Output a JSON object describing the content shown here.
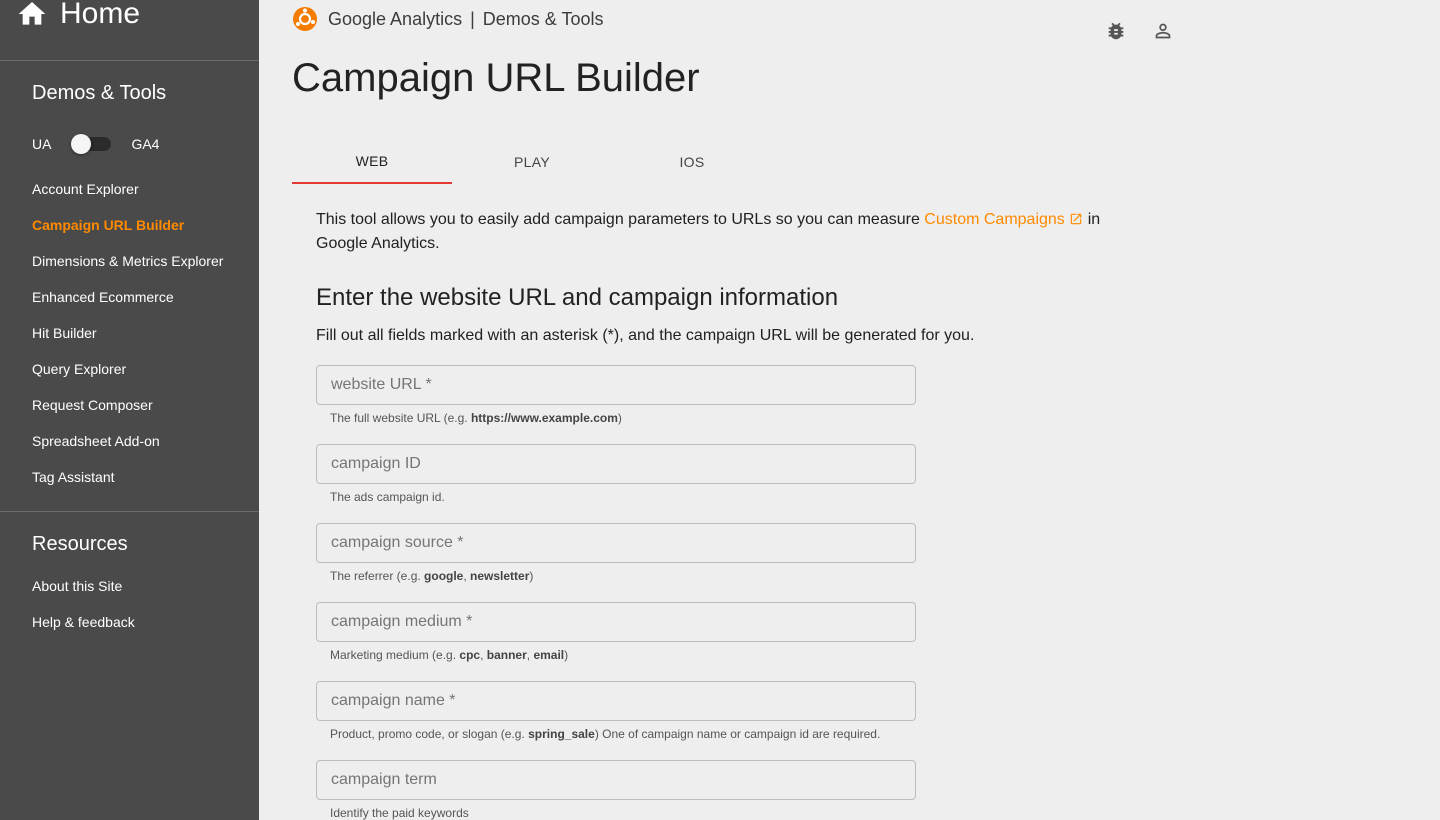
{
  "sidebar": {
    "home_label": "Home",
    "section1_title": "Demos & Tools",
    "toggle_left": "UA",
    "toggle_right": "GA4",
    "items": [
      {
        "label": "Account Explorer",
        "active": false
      },
      {
        "label": "Campaign URL Builder",
        "active": true
      },
      {
        "label": "Dimensions & Metrics Explorer",
        "active": false
      },
      {
        "label": "Enhanced Ecommerce",
        "active": false
      },
      {
        "label": "Hit Builder",
        "active": false
      },
      {
        "label": "Query Explorer",
        "active": false
      },
      {
        "label": "Request Composer",
        "active": false
      },
      {
        "label": "Spreadsheet Add-on",
        "active": false
      },
      {
        "label": "Tag Assistant",
        "active": false
      }
    ],
    "section2_title": "Resources",
    "resources": [
      {
        "label": "About this Site"
      },
      {
        "label": "Help & feedback"
      }
    ]
  },
  "header": {
    "brand": "Google Analytics",
    "separator": "|",
    "product": "Demos & Tools",
    "icons": [
      "bug-icon",
      "account-icon"
    ]
  },
  "page": {
    "title": "Campaign URL Builder",
    "tabs": [
      {
        "label": "WEB",
        "active": true
      },
      {
        "label": "PLAY",
        "active": false
      },
      {
        "label": "IOS",
        "active": false
      }
    ],
    "intro_before": "This tool allows you to easily add campaign parameters to URLs so you can measure ",
    "intro_link": "Custom Campaigns",
    "intro_after": " in Google Analytics.",
    "form_heading": "Enter the website URL and campaign information",
    "form_sub": "Fill out all fields marked with an asterisk (*), and the campaign URL will be generated for you."
  },
  "form": {
    "fields": [
      {
        "placeholder": "website URL *",
        "value": "",
        "helper": [
          "The full website URL (e.g. ",
          "https://www.example.com",
          ")"
        ]
      },
      {
        "placeholder": "campaign ID",
        "value": "",
        "helper": [
          "The ads campaign id."
        ]
      },
      {
        "placeholder": "campaign source *",
        "value": "",
        "helper": [
          "The referrer (e.g. ",
          "google",
          ", ",
          "newsletter",
          ")"
        ]
      },
      {
        "placeholder": "campaign medium *",
        "value": "",
        "helper": [
          "Marketing medium (e.g. ",
          "cpc",
          ", ",
          "banner",
          ", ",
          "email",
          ")"
        ]
      },
      {
        "placeholder": "campaign name *",
        "value": "",
        "helper": [
          "Product, promo code, or slogan (e.g. ",
          "spring_sale",
          ") One of campaign name or campaign id are required."
        ]
      },
      {
        "placeholder": "campaign term",
        "value": "",
        "helper": [
          "Identify the paid keywords"
        ]
      }
    ]
  },
  "colors": {
    "sidebar_bg": "#4a4a4a",
    "accent": "#ff8a00",
    "tab_indicator": "#e53935",
    "page_bg": "#eeeeee"
  }
}
